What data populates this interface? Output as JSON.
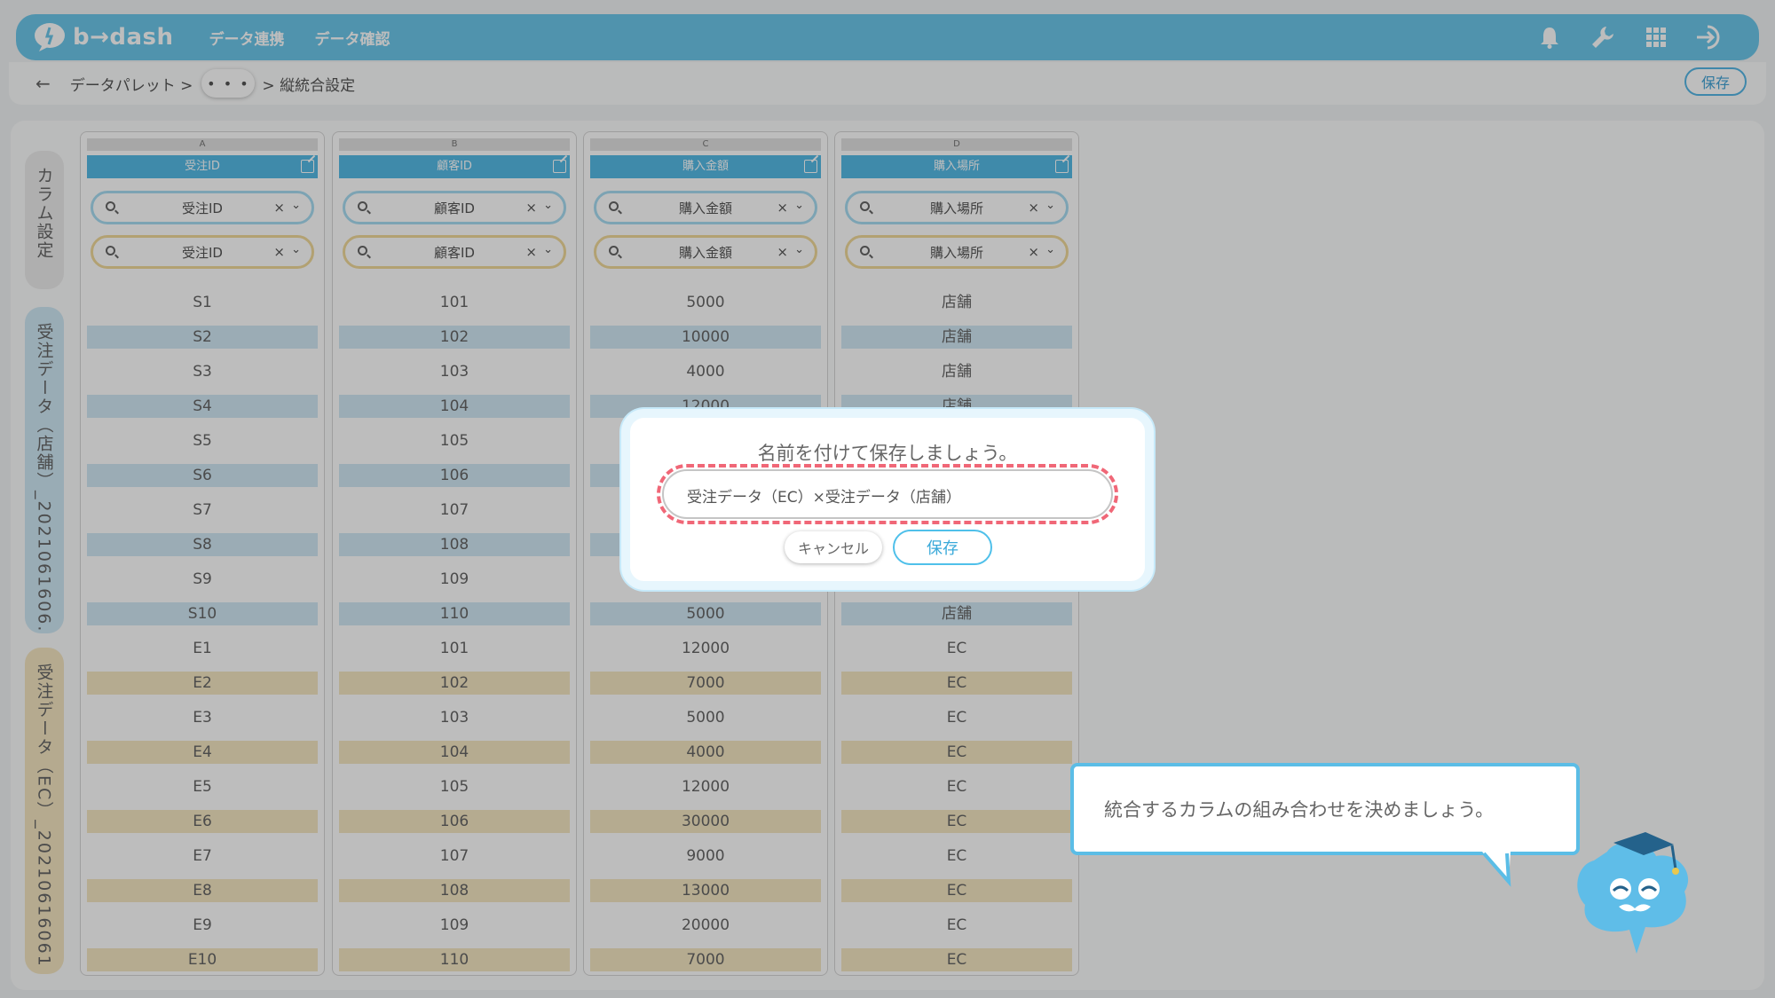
{
  "app": {
    "logo_text": "b→dash"
  },
  "nav": [
    "データ連携",
    "データ確認"
  ],
  "top_icons": [
    "bell-icon",
    "wrench-icon",
    "grid-icon",
    "logout-icon"
  ],
  "breadcrumb": {
    "back": "←",
    "root": "データパレット >",
    "more": "• • •",
    "current": "> 縦統合設定"
  },
  "header_save": "保存",
  "side_tabs": [
    {
      "label": "カラム設定"
    },
    {
      "label": "受注データ（店舗）_2021061606..."
    },
    {
      "label": "受注データ（EC）_20210616061 2..."
    }
  ],
  "columns": [
    {
      "letter": "A",
      "header": "受注ID",
      "select_top": "受注ID",
      "select_bottom": "受注ID",
      "values": [
        "S1",
        "S2",
        "S3",
        "S4",
        "S5",
        "S6",
        "S7",
        "S8",
        "S9",
        "S10",
        "E1",
        "E2",
        "E3",
        "E4",
        "E5",
        "E6",
        "E7",
        "E8",
        "E9",
        "E10"
      ]
    },
    {
      "letter": "B",
      "header": "顧客ID",
      "select_top": "顧客ID",
      "select_bottom": "顧客ID",
      "values": [
        "101",
        "102",
        "103",
        "104",
        "105",
        "106",
        "107",
        "108",
        "109",
        "110",
        "101",
        "102",
        "103",
        "104",
        "105",
        "106",
        "107",
        "108",
        "109",
        "110"
      ]
    },
    {
      "letter": "C",
      "header": "購入金額",
      "select_top": "購入金額",
      "select_bottom": "購入金額",
      "values": [
        "5000",
        "10000",
        "4000",
        "12000",
        "",
        "",
        "",
        "",
        "",
        "5000",
        "12000",
        "7000",
        "5000",
        "4000",
        "12000",
        "30000",
        "9000",
        "13000",
        "20000",
        "7000"
      ]
    },
    {
      "letter": "D",
      "header": "購入場所",
      "select_top": "購入場所",
      "select_bottom": "購入場所",
      "values": [
        "店舗",
        "店舗",
        "店舗",
        "店舗",
        "",
        "",
        "",
        "",
        "",
        "店舗",
        "EC",
        "EC",
        "EC",
        "EC",
        "EC",
        "EC",
        "EC",
        "EC",
        "EC",
        "EC"
      ]
    }
  ],
  "modal": {
    "title": "名前を付けて保存しましょう。",
    "name_value": "受注データ（EC）×受注データ（店舗）",
    "cancel": "キャンセル",
    "save": "保存"
  },
  "hint": "統合するカラムの組み合わせを決めましょう。",
  "colors": {
    "accent": "#56bbe6",
    "highlight": "#f06777",
    "store_row": "#d1e8f4",
    "ec_row": "#f5e7c3"
  }
}
